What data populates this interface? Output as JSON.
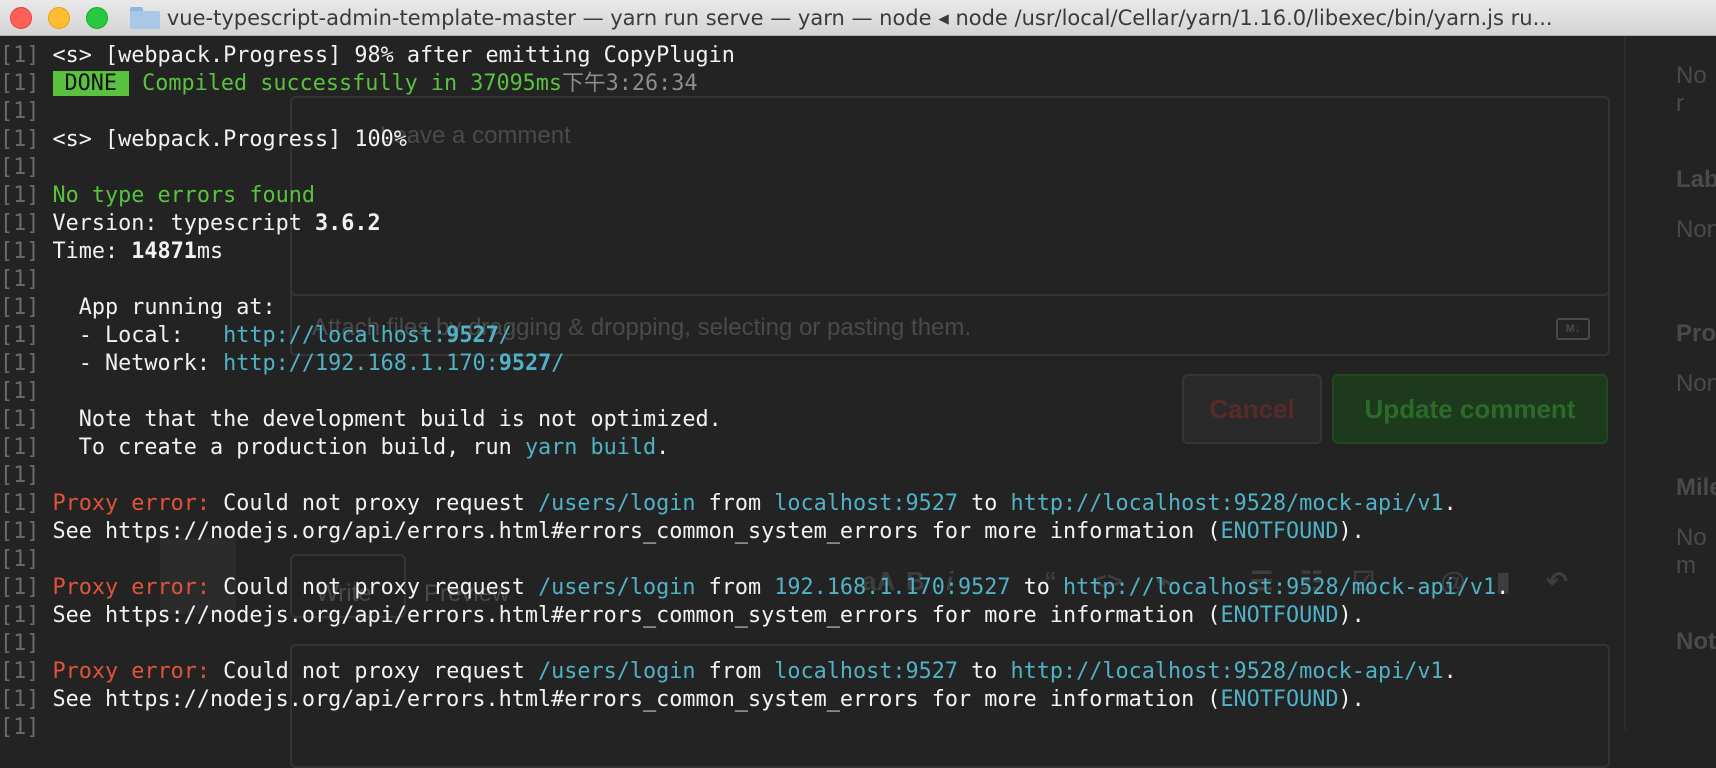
{
  "window": {
    "title": "vue-typescript-admin-template-master — yarn run serve — yarn — node ◂ node /usr/local/Cellar/yarn/1.16.0/libexec/bin/yarn.js ru..."
  },
  "background": {
    "textarea_placeholder": "Leave a comment",
    "attach_hint": "Attach files by dragging & dropping, selecting or pasting them.",
    "cancel_label": "Cancel",
    "update_label": "Update comment",
    "write_tab": "Write",
    "preview_tab": "Preview",
    "markdown_badge": "M↓",
    "sidebar": {
      "no_reviews": "No r",
      "labels_heading": "Lab",
      "labels_value": "Non",
      "projects_heading": "Pro",
      "projects_value": "Non",
      "milestone_heading": "Mile",
      "milestone_value": "No m",
      "notifications_heading": "Not"
    }
  },
  "terminal": {
    "prefix": "[1]",
    "progress98": "<s> [webpack.Progress] 98% after emitting CopyPlugin",
    "done_badge": "DONE",
    "compiled": "Compiled successfully in 37095ms",
    "compiled_time": "下午3:26:34",
    "progress100": "<s> [webpack.Progress] 100%",
    "no_type_errors": "No type errors found",
    "version_label": "Version: typescript ",
    "version_value": "3.6.2",
    "time_label": "Time: ",
    "time_value": "14871",
    "time_unit": "ms",
    "app_running": "  App running at:",
    "local_label": "  - Local:   ",
    "local_url": "http://localhost:",
    "local_port": "9527",
    "local_slash": "/",
    "network_label": "  - Network: ",
    "network_url": "http://192.168.1.170:",
    "network_port": "9527",
    "network_slash": "/",
    "note1": "  Note that the development build is not optimized.",
    "note2_pre": "  To create a production build, run ",
    "note2_cmd": "yarn build",
    "note2_post": ".",
    "errors": [
      {
        "label": "Proxy error:",
        "msg": " Could not proxy request ",
        "path": "/users/login",
        "from": " from ",
        "host": "localhost:9527",
        "to": " to ",
        "target": "http://localhost:9528/mock-api/v1",
        "end": ".",
        "see": "See https://nodejs.org/api/errors.html#errors_common_system_errors for more information (",
        "code": "ENOTFOUND",
        "close": ")."
      },
      {
        "label": "Proxy error:",
        "msg": " Could not proxy request ",
        "path": "/users/login",
        "from": " from ",
        "host": "192.168.1.170:9527",
        "to": " to ",
        "target": "http://localhost:9528/mock-api/v1",
        "end": ".",
        "see": "See https://nodejs.org/api/errors.html#errors_common_system_errors for more information (",
        "code": "ENOTFOUND",
        "close": ")."
      },
      {
        "label": "Proxy error:",
        "msg": " Could not proxy request ",
        "path": "/users/login",
        "from": " from ",
        "host": "localhost:9527",
        "to": " to ",
        "target": "http://localhost:9528/mock-api/v1",
        "end": ".",
        "see": "See https://nodejs.org/api/errors.html#errors_common_system_errors for more information (",
        "code": "ENOTFOUND",
        "close": ")."
      }
    ]
  }
}
